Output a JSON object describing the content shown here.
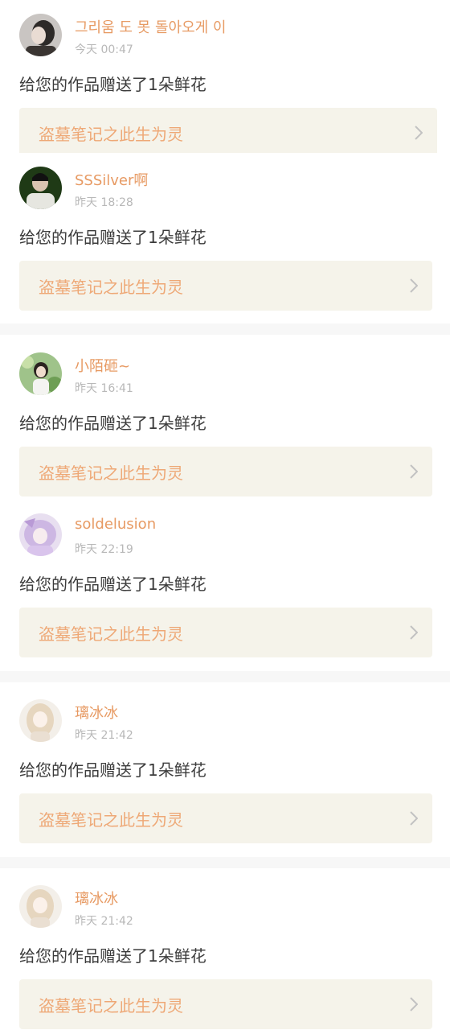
{
  "notifications": [
    {
      "user": "그리움 도 못 돌아오게 이",
      "time": "今天 00:47",
      "message": "给您的作品赠送了1朵鲜花",
      "work_title": "盗墓笔记之此生为灵",
      "avatar_icon": "avatar-dark-hair"
    },
    {
      "user": "SSSilver啊",
      "time": "昨天 18:28",
      "message": "给您的作品赠送了1朵鲜花",
      "work_title": "盗墓笔记之此生为灵",
      "avatar_icon": "avatar-green-jacket"
    },
    {
      "user": "小陌砸~",
      "time": "昨天 16:41",
      "message": "给您的作品赠送了1朵鲜花",
      "work_title": "盗墓笔记之此生为灵",
      "avatar_icon": "avatar-girl-garden"
    },
    {
      "user": "soldelusion",
      "time": "昨天 22:19",
      "message": "给您的作品赠送了1朵鲜花",
      "work_title": "盗墓笔记之此生为灵",
      "avatar_icon": "avatar-anime-purple"
    },
    {
      "user": "璃冰冰",
      "time": "昨天 21:42",
      "message": "给您的作品赠送了1朵鲜花",
      "work_title": "盗墓笔记之此生为灵",
      "avatar_icon": "avatar-anime-blonde"
    },
    {
      "user": "璃冰冰",
      "time": "昨天 21:42",
      "message": "给您的作品赠送了1朵鲜花",
      "work_title": "盗墓笔记之此生为灵",
      "avatar_icon": "avatar-anime-blonde"
    }
  ],
  "colors": {
    "username": "#e79a63",
    "work_title": "#eea876",
    "card_bg": "#f5f3ea",
    "time": "#b8b8b8",
    "message": "#3b3b3b"
  }
}
